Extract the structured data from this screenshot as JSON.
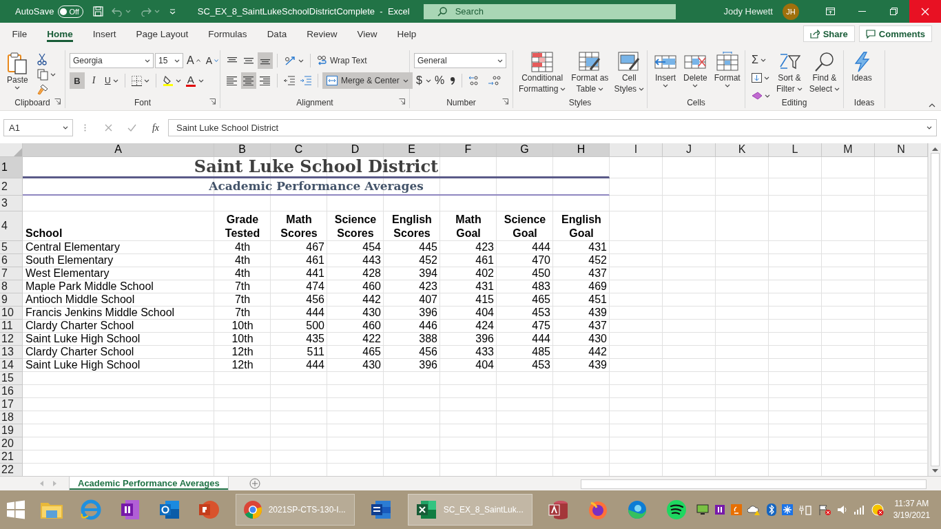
{
  "title_bar": {
    "autosave_label": "AutoSave",
    "autosave": {
      "on": false,
      "state_text": "Off"
    },
    "document": "SC_EX_8_SaintLukeSchoolDistrictComplete  -  Excel",
    "search_placeholder": "Search",
    "user": "Jody Hewett",
    "initials": "JH"
  },
  "menu_tabs": [
    {
      "label": "File",
      "selected": false
    },
    {
      "label": "Home",
      "selected": true
    },
    {
      "label": "Insert",
      "selected": false
    },
    {
      "label": "Page Layout",
      "selected": false
    },
    {
      "label": "Formulas",
      "selected": false
    },
    {
      "label": "Data",
      "selected": false
    },
    {
      "label": "Review",
      "selected": false
    },
    {
      "label": "View",
      "selected": false
    },
    {
      "label": "Help",
      "selected": false
    }
  ],
  "share": "Share",
  "comments": "Comments",
  "ribbon": {
    "clipboard": {
      "label": "Clipboard",
      "paste": "Paste"
    },
    "font": {
      "label": "Font",
      "font_name": "Georgia",
      "font_size": "15",
      "grow": "A",
      "shrink": "A",
      "bold": {
        "text": "B",
        "on": true
      },
      "italic": {
        "text": "I",
        "on": false
      },
      "underline": {
        "text": "U",
        "on": false
      },
      "font_color": "A"
    },
    "alignment": {
      "label": "Alignment",
      "vertical_align": [
        {
          "on": false
        },
        {
          "on": false
        },
        {
          "on": true
        }
      ],
      "horizontal_align": [
        {
          "on": false
        },
        {
          "on": true
        },
        {
          "on": false
        }
      ],
      "wrap_text": {
        "label": "Wrap Text",
        "on": false
      },
      "merge": {
        "label": "Merge & Center",
        "on": true
      }
    },
    "number": {
      "label": "Number",
      "format": "General",
      "currency": "$",
      "percent": "%"
    },
    "styles": {
      "label": "Styles",
      "buttons": [
        {
          "lines": [
            "Conditional",
            "Formatting"
          ]
        },
        {
          "lines": [
            "Format as",
            "Table"
          ]
        },
        {
          "lines": [
            "Cell",
            "Styles"
          ]
        }
      ]
    },
    "cells": {
      "label": "Cells",
      "buttons": [
        {
          "lines": [
            "Insert"
          ]
        },
        {
          "lines": [
            "Delete"
          ]
        },
        {
          "lines": [
            "Format"
          ]
        }
      ]
    },
    "editing": {
      "label": "Editing",
      "autosum": "Σ",
      "buttons": [
        {
          "lines": [
            "Sort &",
            "Filter"
          ]
        },
        {
          "lines": [
            "Find &",
            "Select"
          ]
        }
      ]
    },
    "ideas": {
      "label": "Ideas",
      "buttons": [
        {
          "lines": [
            "Ideas"
          ]
        }
      ]
    }
  },
  "formula_bar": {
    "name_box": "A1",
    "fx": "fx",
    "formula": "Saint Luke School District"
  },
  "sheet": {
    "columns": [
      {
        "label": "A",
        "selected": true
      },
      {
        "label": "B",
        "selected": true
      },
      {
        "label": "C",
        "selected": true
      },
      {
        "label": "D",
        "selected": true
      },
      {
        "label": "E",
        "selected": true
      },
      {
        "label": "F",
        "selected": true
      },
      {
        "label": "G",
        "selected": true
      },
      {
        "label": "H",
        "selected": true
      },
      {
        "label": "I",
        "selected": false
      },
      {
        "label": "J",
        "selected": false
      },
      {
        "label": "K",
        "selected": false
      },
      {
        "label": "L",
        "selected": false
      },
      {
        "label": "M",
        "selected": false
      },
      {
        "label": "N",
        "selected": false
      }
    ],
    "row_numbers": [
      {
        "label": "1",
        "selected": true
      },
      {
        "label": "2",
        "selected": false
      },
      {
        "label": "3",
        "selected": false
      },
      {
        "label": "4",
        "selected": false
      },
      {
        "label": "5",
        "selected": false
      },
      {
        "label": "6",
        "selected": false
      },
      {
        "label": "7",
        "selected": false
      },
      {
        "label": "8",
        "selected": false
      },
      {
        "label": "9",
        "selected": false
      },
      {
        "label": "10",
        "selected": false
      },
      {
        "label": "11",
        "selected": false
      },
      {
        "label": "12",
        "selected": false
      },
      {
        "label": "13",
        "selected": false
      },
      {
        "label": "14",
        "selected": false
      },
      {
        "label": "15",
        "selected": false
      },
      {
        "label": "16",
        "selected": false
      },
      {
        "label": "17",
        "selected": false
      },
      {
        "label": "18",
        "selected": false
      },
      {
        "label": "19",
        "selected": false
      },
      {
        "label": "20",
        "selected": false
      },
      {
        "label": "21",
        "selected": false
      },
      {
        "label": "22",
        "selected": false
      }
    ],
    "title": "Saint Luke School District",
    "subtitle": "Academic Performance Averages",
    "headers": [
      [
        "School"
      ],
      [
        "Grade",
        "Tested"
      ],
      [
        "Math",
        "Scores"
      ],
      [
        "Science",
        "Scores"
      ],
      [
        "English",
        "Scores"
      ],
      [
        "Math",
        "Goal"
      ],
      [
        "Science",
        "Goal"
      ],
      [
        "English",
        "Goal"
      ]
    ],
    "rows": [
      {
        "school": "Central Elementary",
        "grade": "4th",
        "values": [
          "467",
          "454",
          "445",
          "423",
          "444",
          "431"
        ]
      },
      {
        "school": "South Elementary",
        "grade": "4th",
        "values": [
          "461",
          "443",
          "452",
          "461",
          "470",
          "452"
        ]
      },
      {
        "school": "West Elementary",
        "grade": "4th",
        "values": [
          "441",
          "428",
          "394",
          "402",
          "450",
          "437"
        ]
      },
      {
        "school": "Maple Park Middle School",
        "grade": "7th",
        "values": [
          "474",
          "460",
          "423",
          "431",
          "483",
          "469"
        ]
      },
      {
        "school": "Antioch Middle School",
        "grade": "7th",
        "values": [
          "456",
          "442",
          "407",
          "415",
          "465",
          "451"
        ]
      },
      {
        "school": "Francis Jenkins Middle School",
        "grade": "7th",
        "values": [
          "444",
          "430",
          "396",
          "404",
          "453",
          "439"
        ]
      },
      {
        "school": "Clardy Charter School",
        "grade": "10th",
        "values": [
          "500",
          "460",
          "446",
          "424",
          "475",
          "437"
        ]
      },
      {
        "school": "Saint Luke High School",
        "grade": "10th",
        "values": [
          "435",
          "422",
          "388",
          "396",
          "444",
          "430"
        ]
      },
      {
        "school": "Clardy Charter School",
        "grade": "12th",
        "values": [
          "511",
          "465",
          "456",
          "433",
          "485",
          "442"
        ]
      },
      {
        "school": "Saint Luke High School",
        "grade": "12th",
        "values": [
          "444",
          "430",
          "396",
          "404",
          "453",
          "439"
        ]
      }
    ]
  },
  "sheet_tabs": [
    {
      "label": "Academic Performance Averages",
      "selected": true
    }
  ],
  "taskbar": {
    "windows": [
      {
        "label": "2021SP-CTS-130-I...",
        "active": false
      },
      {
        "label": "SC_EX_8_SaintLuk...",
        "active": true
      }
    ],
    "time": "11:37 AM",
    "date": "3/19/2021"
  }
}
